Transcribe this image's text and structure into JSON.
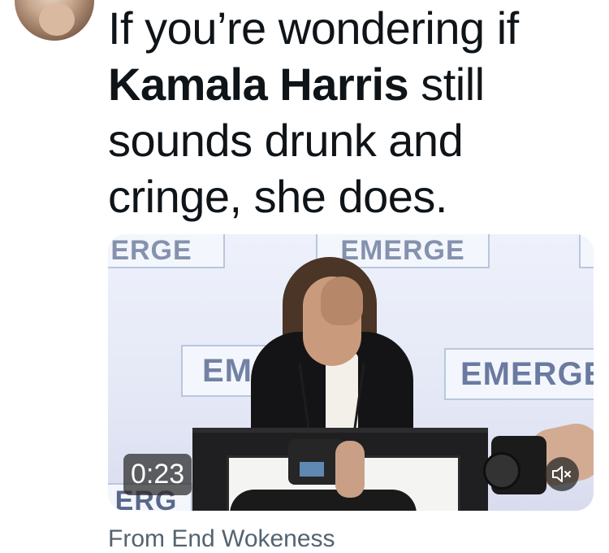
{
  "tweet": {
    "line1": "If you’re wondering if",
    "bold_name": "Kamala Harris",
    "line2_rest": " still",
    "line3": "sounds drunk and",
    "line4": "cringe, she does."
  },
  "media": {
    "banner_texts": [
      "EMERGE",
      "EMERGE",
      "EM",
      "EMERGE",
      "ERG"
    ],
    "duration": "0:23",
    "mute_icon": "speaker-muted-icon"
  },
  "attribution": "From End Wokeness"
}
